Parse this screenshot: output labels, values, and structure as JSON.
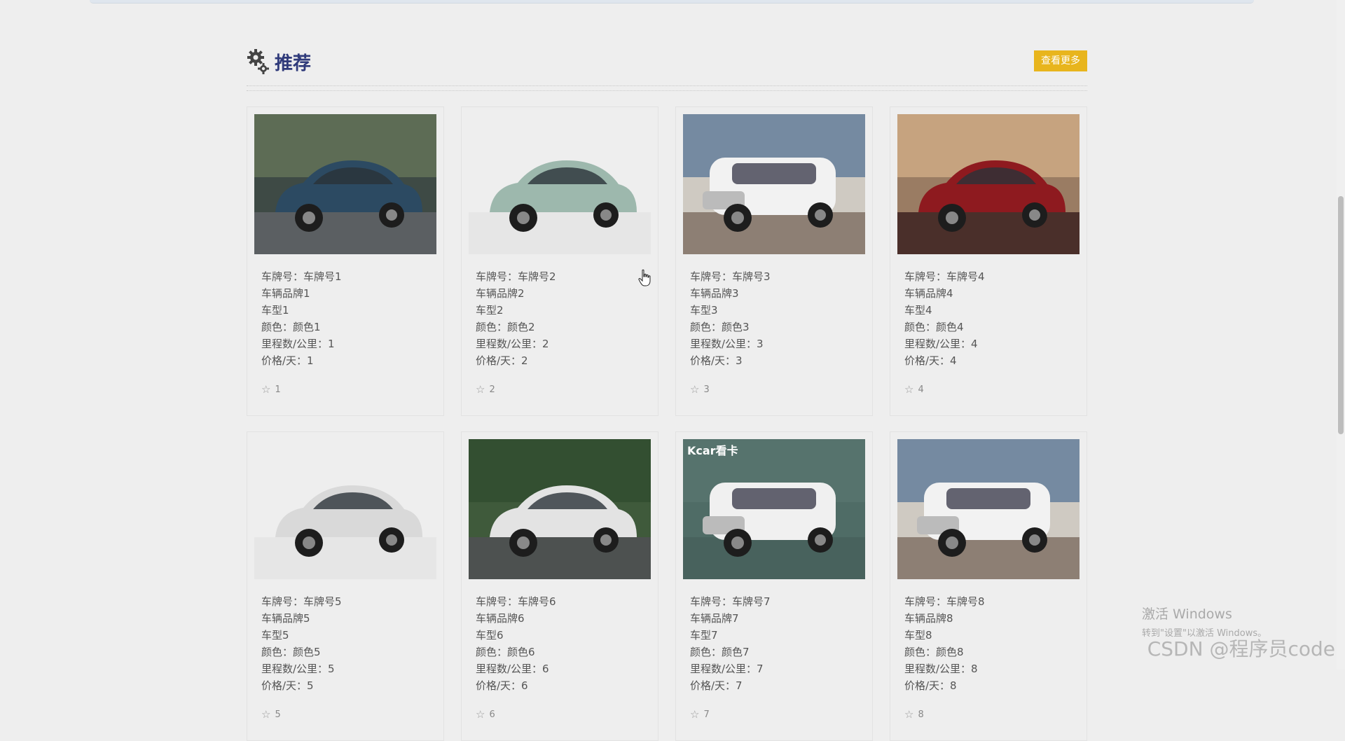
{
  "section": {
    "title": "推荐",
    "more_label": "查看更多"
  },
  "cars": [
    {
      "plate": "车牌号：车牌号1",
      "brand": "车辆品牌1",
      "model": "车型1",
      "color": "颜色：颜色1",
      "mileage": "里程数/公里：1",
      "price": "价格/天：1",
      "fav": "1",
      "img": {
        "bg": "#3e4a45",
        "body": "#2c4a62",
        "ground": "#5b5f62",
        "sky": "#6b7a5c"
      }
    },
    {
      "plate": "车牌号：车牌号2",
      "brand": "车辆品牌2",
      "model": "车型2",
      "color": "颜色：颜色2",
      "mileage": "里程数/公里：2",
      "price": "价格/天：2",
      "fav": "2",
      "img": {
        "bg": "#eeeeee",
        "body": "#9db8ad",
        "ground": "#e6e6e6",
        "sky": "#eeeeee"
      }
    },
    {
      "plate": "车牌号：车牌号3",
      "brand": "车辆品牌3",
      "model": "车型3",
      "color": "颜色：颜色3",
      "mileage": "里程数/公里：3",
      "price": "价格/天：3",
      "fav": "3",
      "img": {
        "bg": "#cfcac2",
        "body": "#f2f2f2",
        "ground": "#8d7f74",
        "sky": "#4f6f93"
      }
    },
    {
      "plate": "车牌号：车牌号4",
      "brand": "车辆品牌4",
      "model": "车型4",
      "color": "颜色：颜色4",
      "mileage": "里程数/公里：4",
      "price": "价格/天：4",
      "fav": "4",
      "img": {
        "bg": "#9a7c63",
        "body": "#8e1a1f",
        "ground": "#4a2f2a",
        "sky": "#d8b48c"
      }
    },
    {
      "plate": "车牌号：车牌号5",
      "brand": "车辆品牌5",
      "model": "车型5",
      "color": "颜色：颜色5",
      "mileage": "里程数/公里：5",
      "price": "价格/天：5",
      "fav": "5",
      "img": {
        "bg": "#eeeeee",
        "body": "#d9d9d9",
        "ground": "#e6e6e6",
        "sky": "#eeeeee"
      }
    },
    {
      "plate": "车牌号：车牌号6",
      "brand": "车辆品牌6",
      "model": "车型6",
      "color": "颜色：颜色6",
      "mileage": "里程数/公里：6",
      "price": "价格/天：6",
      "fav": "6",
      "img": {
        "bg": "#3f5a3b",
        "body": "#e3e3e3",
        "ground": "#4d5150",
        "sky": "#2f4a2e"
      }
    },
    {
      "plate": "车牌号：车牌号7",
      "brand": "车辆品牌7",
      "model": "车型7",
      "color": "颜色：颜色7",
      "mileage": "里程数/公里：7",
      "price": "价格/天：7",
      "fav": "7",
      "img": {
        "bg": "#4f6c66",
        "body": "#f0f0f0",
        "ground": "#48625d",
        "sky": "#5a7670",
        "badge": "Kcar看卡"
      }
    },
    {
      "plate": "车牌号：车牌号8",
      "brand": "车辆品牌8",
      "model": "车型8",
      "color": "颜色：颜色8",
      "mileage": "里程数/公里：8",
      "price": "价格/天：8",
      "fav": "8",
      "img": {
        "bg": "#cfcac2",
        "body": "#f2f2f2",
        "ground": "#8d7f74",
        "sky": "#4f6f93"
      }
    }
  ],
  "watermark": {
    "line1": "激活 Windows",
    "line2": "转到\"设置\"以激活 Windows。"
  },
  "csdn_mark": "CSDN @程序员code"
}
